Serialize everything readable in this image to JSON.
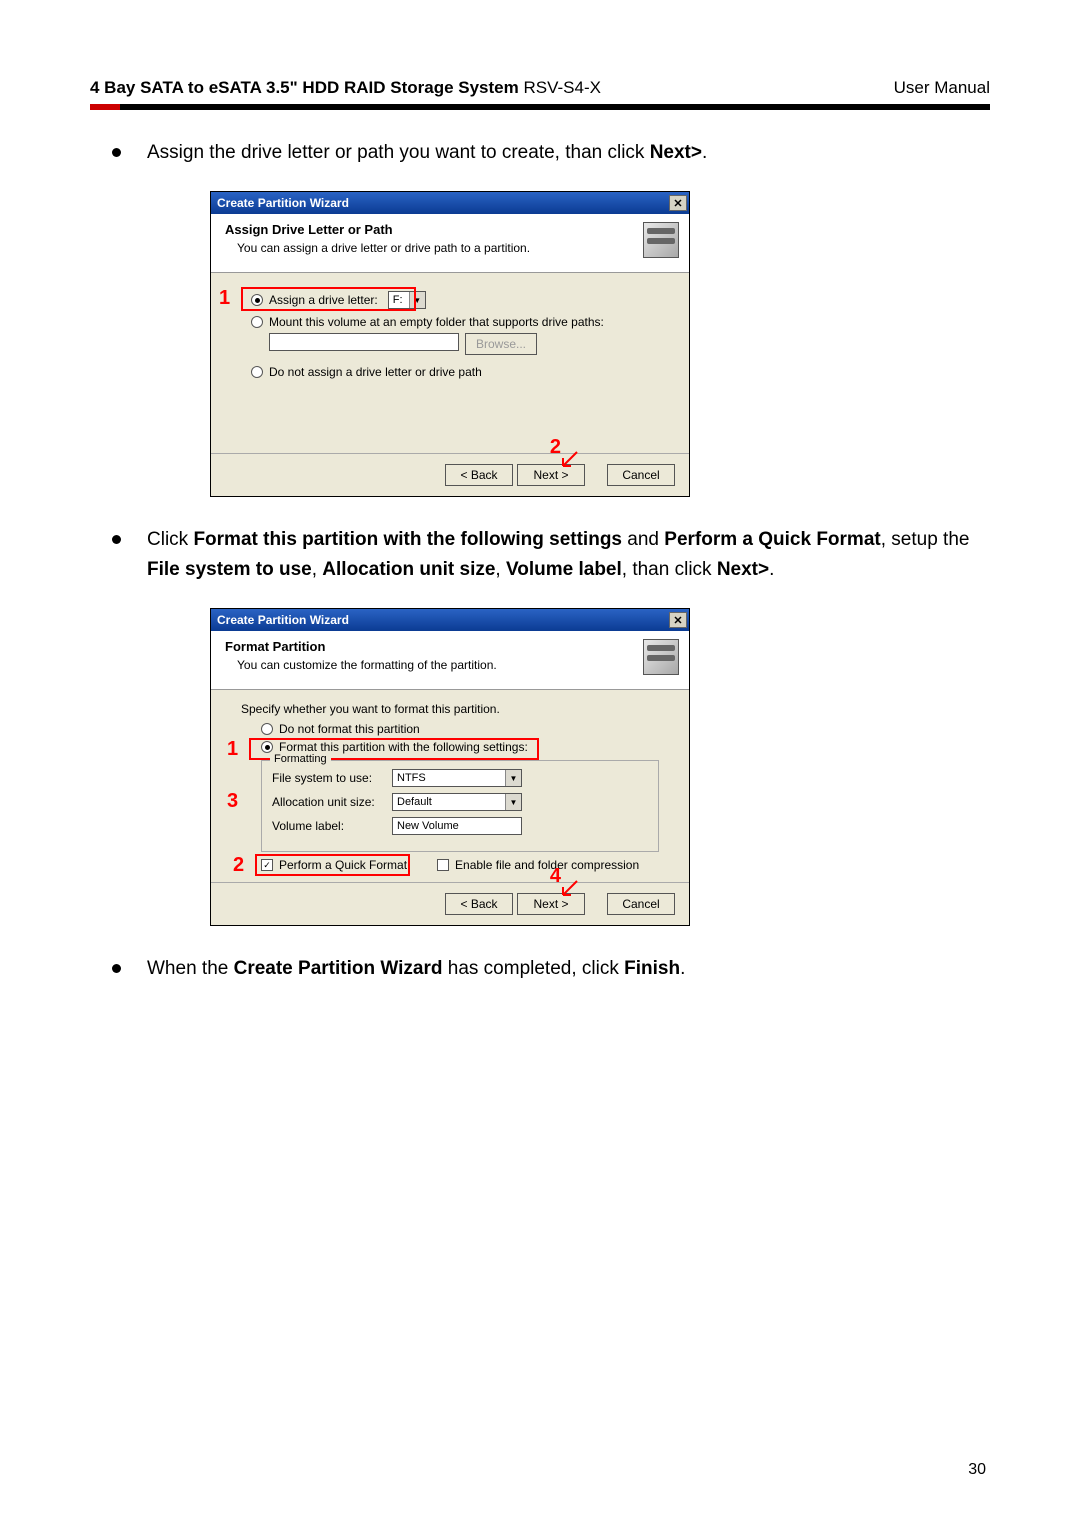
{
  "header": {
    "left_bold": "4 Bay SATA to eSATA 3.5\" HDD RAID Storage System",
    "left_normal": " RSV-S4-X",
    "right": "User Manual"
  },
  "bullets": {
    "b1": {
      "pre": "Assign the drive letter or path you want to create, than click ",
      "bold": "Next>",
      "post": "."
    },
    "b2": {
      "pre": "Click ",
      "bold1": "Format this partition with the following settings",
      "mid1": " and ",
      "bold2": "Perform a Quick Format",
      "mid2": ", setup the ",
      "bold3": "File system to use",
      "mid3": ", ",
      "bold4": "Allocation unit size",
      "mid4": ", ",
      "bold5": "Volume label",
      "mid5": ", than click ",
      "bold6": "Next>",
      "post": "."
    },
    "b3": {
      "pre": "When the ",
      "bold1": "Create Partition Wizard",
      "mid": " has completed, click ",
      "bold2": "Finish",
      "post": "."
    }
  },
  "dialog1": {
    "title": "Create Partition Wizard",
    "head_title": "Assign Drive Letter or Path",
    "head_sub": "You can assign a drive letter or drive path to a partition.",
    "r1_label": "Assign a drive letter:",
    "r1_value": "F:",
    "r2_label": "Mount this volume at an empty folder that supports drive paths:",
    "browse": "Browse...",
    "r3_label": "Do not assign a drive letter or drive path",
    "back": "< Back",
    "next": "Next >",
    "cancel": "Cancel",
    "callout1": "1",
    "callout2": "2"
  },
  "dialog2": {
    "title": "Create Partition Wizard",
    "head_title": "Format Partition",
    "head_sub": "You can customize the formatting of the partition.",
    "specify": "Specify whether you want to format this partition.",
    "r1_label": "Do not format this partition",
    "r2_label": "Format this partition with the following settings:",
    "legend": "Formatting",
    "fs_label": "File system to use:",
    "fs_value": "NTFS",
    "au_label": "Allocation unit size:",
    "au_value": "Default",
    "vl_label": "Volume label:",
    "vl_value": "New Volume",
    "quick": "Perform a Quick Format",
    "compress": "Enable file and folder compression",
    "back": "< Back",
    "next": "Next >",
    "cancel": "Cancel",
    "callout1": "1",
    "callout2": "2",
    "callout3": "3",
    "callout4": "4"
  },
  "page_number": "30"
}
